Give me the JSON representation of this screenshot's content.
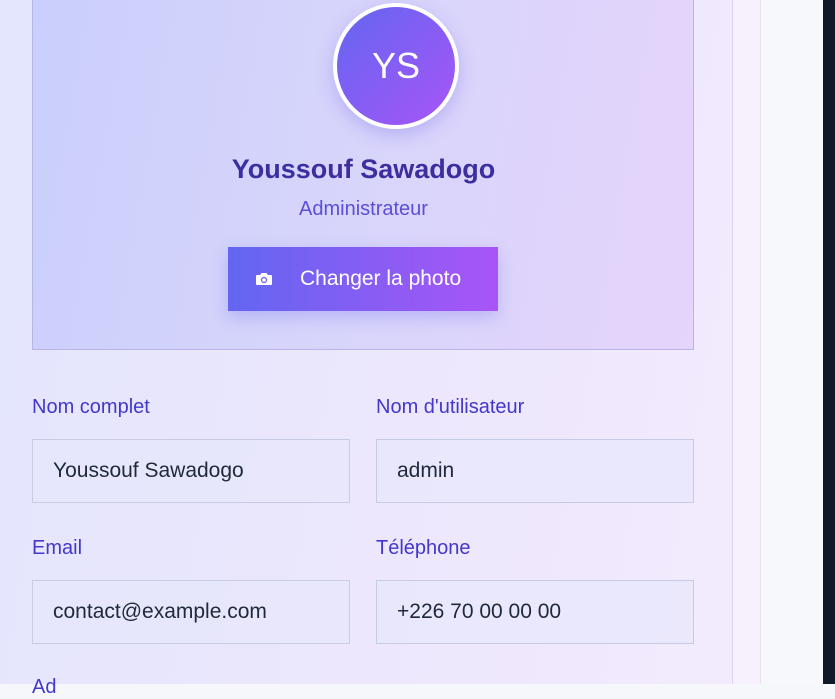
{
  "profile": {
    "initials": "YS",
    "name": "Youssouf Sawadogo",
    "role": "Administrateur",
    "change_photo_label": "Changer la photo",
    "change_photo_icon": "camera-icon"
  },
  "form": {
    "full_name": {
      "label": "Nom complet",
      "value": "Youssouf Sawadogo"
    },
    "username": {
      "label": "Nom d'utilisateur",
      "value": "admin"
    },
    "email": {
      "label": "Email",
      "value": "contact@example.com"
    },
    "phone": {
      "label": "Téléphone",
      "value": "+226 70 00 00 00"
    },
    "address_label_partial": "Ad"
  },
  "colors": {
    "accent_start": "#6366f1",
    "accent_end": "#a855f7",
    "label": "#4338ca",
    "name": "#3b2fa0"
  }
}
